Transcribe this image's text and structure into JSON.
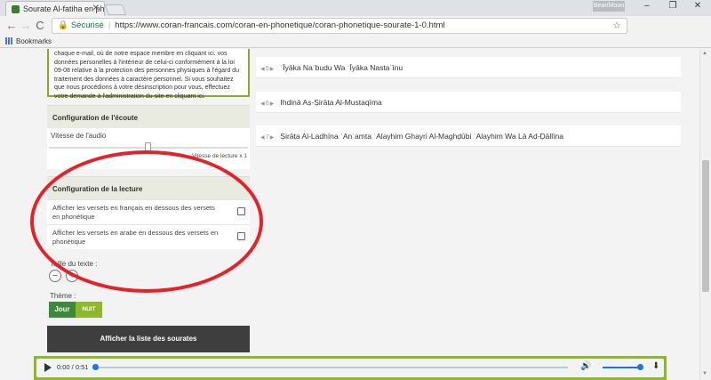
{
  "browser": {
    "tab_title": "Sourate Al-fatiha en phc",
    "tab_close": "✕",
    "user_badge": "Bear/Moon",
    "win_minimize": "–",
    "win_maximize": "❐",
    "win_close": "✕",
    "nav_back": "←",
    "nav_forward": "→",
    "nav_reload": "C",
    "secure_label": "Sécurisé",
    "url": "https://www.coran-francais.com/coran-en-phonetique/coran-phonetique-sourate-1-0.html",
    "menu": "⋮",
    "bookmarks_label": "Bookmarks"
  },
  "sidebar": {
    "gdpr_text": "chaque e-mail, où de notre espace membre en cliquant ici. vos données personelles à l'intérieur de celui-ci conformément à la loi 09-08 relative à la protection des personnes physiques à l'égard du traitement des données à caractère personnel. Si vous souhaitez que nous procédions à votre désinscription pour vous, effectuez votre demande à l'administration du site en cliquant ici.",
    "listen_config": {
      "title": "Configuration de l'écoute",
      "speed_label": "Vitesse de l'audio",
      "speed_value": "Vitesse de lecture x 1"
    },
    "reading_config": {
      "title": "Configuration de la lecture",
      "options": [
        {
          "label": "Afficher les versets en français en dessous des versets en phonétique",
          "checked": false
        },
        {
          "label": "Afficher les versets en arabe en dessous des versets en phonétique",
          "checked": false
        }
      ],
      "text_size_label": "Taille du texte :",
      "minus": "−",
      "plus": "+",
      "theme_label": "Thème :",
      "theme_day": "Jour",
      "theme_night": "NUIT"
    },
    "list_button": "Afficher la liste des sourates"
  },
  "verses": [
    {
      "num": "5",
      "text": "ʾĪyāka Naʿbudu Wa ʾĪyāka Nastaʿīnu"
    },
    {
      "num": "6",
      "text": "Ihdinā Aṣ-Ṣirāṭa Al-Mustaqīma"
    },
    {
      "num": "7",
      "text": "Ṣirāṭa Al-Ladhīna ʾAnʿamta ʿAlayhim Ghayri Al-Maghḍūbi ʿAlayhim Wa Lā Aḍ-Ḍāllīna"
    }
  ],
  "audio": {
    "time": "0:00 / 0:51",
    "progress": 0,
    "volume": 1.0
  },
  "colors": {
    "accent_green": "#8db82a",
    "day_button": "#3a8a3a",
    "night_button": "#8db82a",
    "annotation_red": "#e2232a"
  }
}
